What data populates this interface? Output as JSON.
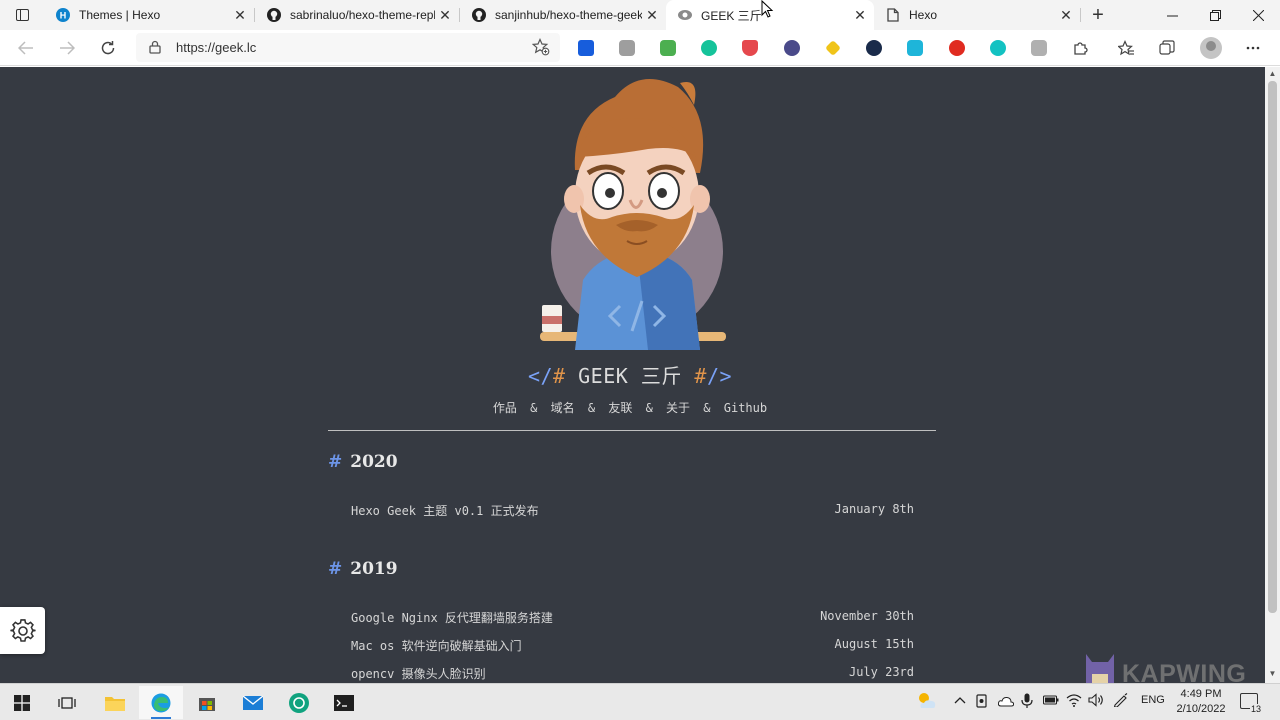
{
  "browser": {
    "tabs": [
      {
        "title": "Themes | Hexo",
        "icon": "hexo-favicon"
      },
      {
        "title": "sabrinaluo/hexo-theme-replica",
        "icon": "github-favicon"
      },
      {
        "title": "sanjinhub/hexo-theme-geek",
        "icon": "github-favicon"
      },
      {
        "title": "GEEK 三斤",
        "icon": "geek-favicon",
        "active": true
      },
      {
        "title": "Hexo",
        "icon": "page-icon"
      }
    ],
    "new_tab": "+",
    "close_glyph": "✕",
    "url": "https://geek.lc"
  },
  "site": {
    "title_open": "</",
    "title_hash_open": "#",
    "title_text": " GEEK 三斤 ",
    "title_hash_close": "#",
    "title_close": "/>",
    "nav": [
      "作品",
      "域名",
      "友联",
      "关于",
      "Github"
    ],
    "nav_separator": "&"
  },
  "archive": [
    {
      "year": "2020",
      "posts": [
        {
          "title": "Hexo Geek 主题 v0.1 正式发布",
          "date": "January 8th"
        }
      ]
    },
    {
      "year": "2019",
      "posts": [
        {
          "title": "Google Nginx 反代理翻墙服务搭建",
          "date": "November 30th"
        },
        {
          "title": "Mac os 软件逆向破解基础入门",
          "date": "August 15th"
        },
        {
          "title": "opencv 摄像头人脸识别",
          "date": "July 23rd"
        }
      ]
    }
  ],
  "year_hash": "#",
  "watermark": "KAPWING",
  "taskbar": {
    "language": "ENG",
    "time": "4:49 PM",
    "date": "2/10/2022",
    "notifications": "13"
  },
  "colors": {
    "page_bg": "#363a42",
    "accent_blue": "#7aa2f7",
    "accent_orange": "#e0944a"
  }
}
